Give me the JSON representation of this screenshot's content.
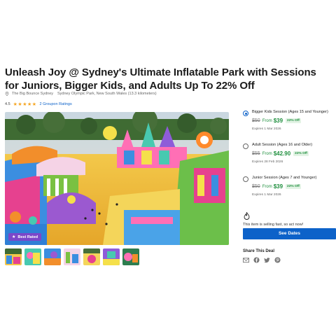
{
  "deal": {
    "title": "Unleash Joy @ Sydney's Ultimate Inflatable Park with Sessions for Juniors, Bigger Kids, and Adults Up To 22% Off",
    "merchant": "The Big Bounce Sydney",
    "location": "Sydney Olympic Park, New South Wales (13.3 kilometers)",
    "rating_value": "4.5",
    "stars": "★★★★★",
    "rating_count": "2 Groupon Ratings",
    "badge": "Best Rated"
  },
  "options": [
    {
      "label": "Bigger Kids Session (Ages 15 and Younger)",
      "original": "$50",
      "from": "From",
      "price": "$39",
      "discount": "22% Off",
      "expires": "Expires 1 Mar 2026",
      "selected": true
    },
    {
      "label": "Adult Session (Ages 16 and Older)",
      "original": "$55",
      "from": "From",
      "price": "$42.90",
      "discount": "22% Off",
      "expires": "Expires 28 Feb 2026",
      "selected": false
    },
    {
      "label": "Junior Session (Ages 7 and Younger)",
      "original": "$50",
      "from": "From",
      "price": "$39",
      "discount": "22% Off",
      "expires": "Expires 1 Mar 2026",
      "selected": false
    }
  ],
  "urgency": "This item is selling fast, so act now!",
  "cta_label": "See Dates",
  "share": {
    "title": "Share This Deal",
    "icons": [
      "email-icon",
      "facebook-icon",
      "twitter-icon",
      "pinterest-icon"
    ]
  },
  "colors": {
    "accent": "#0d62c9",
    "price_green": "#1f8f3e",
    "badge_purple": "#7b47c9",
    "star": "#f5a623"
  }
}
